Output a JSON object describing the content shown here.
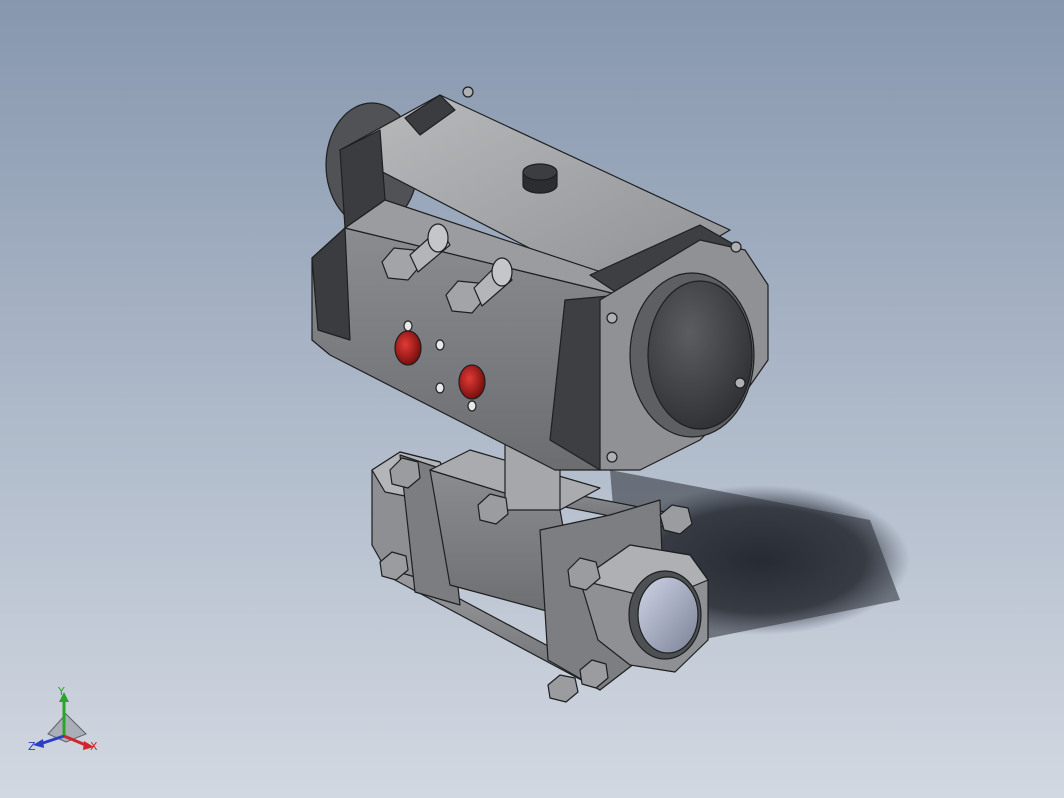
{
  "viewport": {
    "model": "pneumatic-actuated-3pc-ball-valve",
    "background_top": "#8797ae",
    "background_bottom": "#d2d8e1"
  },
  "triad": {
    "x_label": "X",
    "y_label": "Y",
    "z_label": "Z",
    "x_color": "#d0262b",
    "y_color": "#2aa52a",
    "z_color": "#2b3fc4"
  }
}
